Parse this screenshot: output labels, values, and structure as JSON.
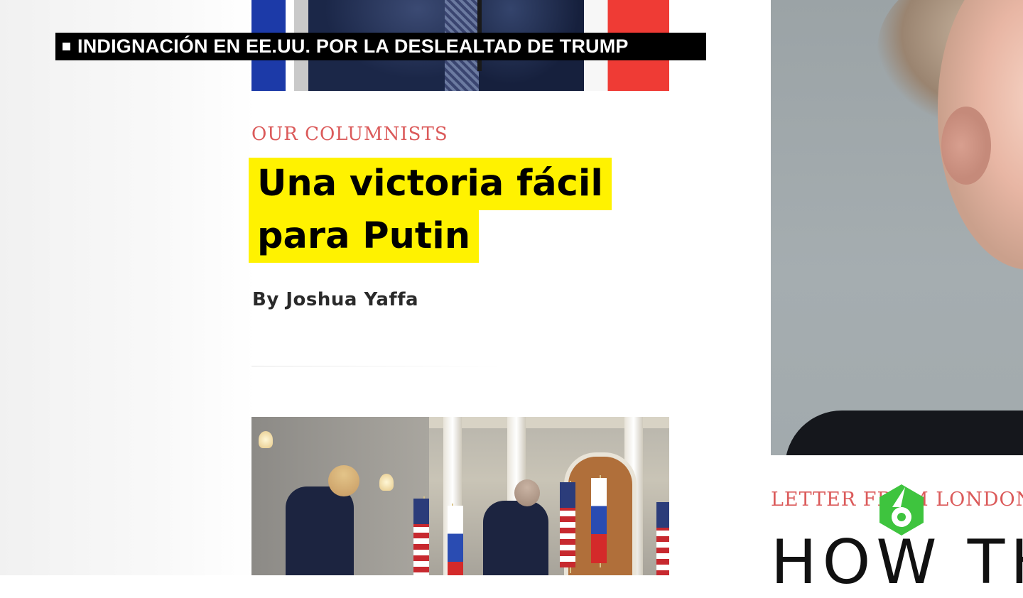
{
  "ticker": {
    "text": "INDIGNACIÓN EN EE.UU. POR LA DESLEALTAD DE TRUMP"
  },
  "article": {
    "kicker": "OUR COLUMNISTS",
    "headline_lines": [
      "Una victoria fácil",
      "para Putin"
    ],
    "byline": "By Joshua Yaffa"
  },
  "sidebar_article": {
    "kicker": "LETTER FROM LONDON",
    "headline": "HOW TH"
  },
  "colors": {
    "highlight": "#fff200",
    "kicker": "#db5a5a",
    "ticker_bg": "#000000",
    "logo_green": "#3ec43e"
  },
  "icons": {
    "channel_logo": "lasexta-6-logo",
    "ticker_bullet": "square-bullet"
  }
}
